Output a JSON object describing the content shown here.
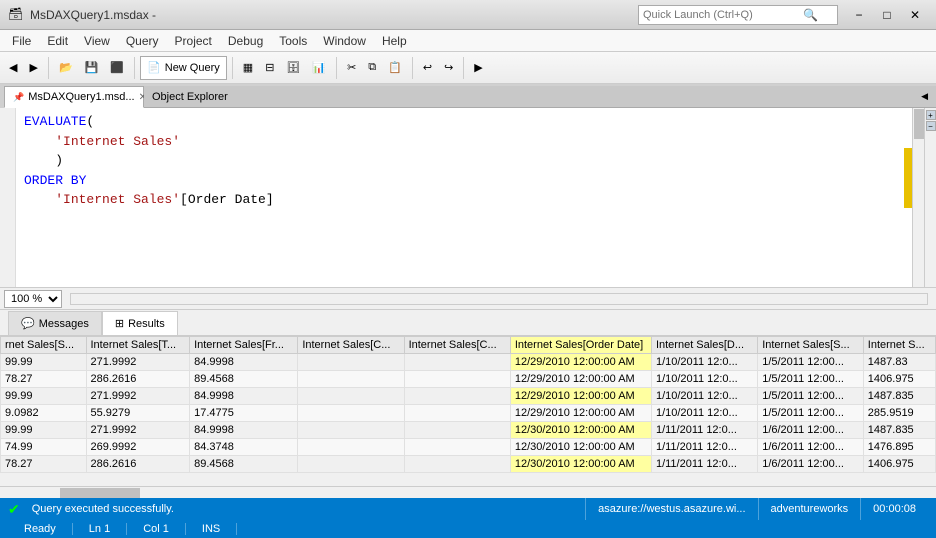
{
  "titleBar": {
    "icon": "⊞",
    "title": "MsDAXQuery1.msdax -",
    "searchPlaceholder": "Quick Launch (Ctrl+Q)",
    "minimize": "−",
    "maximize": "□",
    "close": "✕"
  },
  "menuBar": {
    "items": [
      "File",
      "Edit",
      "View",
      "Query",
      "Project",
      "Debug",
      "Tools",
      "Window",
      "Help"
    ]
  },
  "toolbar": {
    "newQueryLabel": "New Query"
  },
  "tabs": {
    "editorTab": "MsDAXQuery1.msd...",
    "objectExplorer": "Object Explorer"
  },
  "editor": {
    "line1": "EVALUATE(",
    "line2": "    'Internet Sales'",
    "line3": "    )",
    "line4": "ORDER BY",
    "line5": "    'Internet Sales'[Order Date]"
  },
  "zoom": {
    "value": "100 %"
  },
  "resultsTabs": {
    "messages": "Messages",
    "results": "Results"
  },
  "tableHeaders": [
    "rnet Sales[S...",
    "Internet Sales[T...",
    "Internet Sales[Fr...",
    "Internet Sales[C...",
    "Internet Sales[C...",
    "Internet Sales[Order Date]",
    "Internet Sales[D...",
    "Internet Sales[S...",
    "Internet S..."
  ],
  "tableRows": [
    [
      "99.99",
      "271.9992",
      "84.9998",
      "",
      "",
      "12/29/2010 12:00:00 AM",
      "1/10/2011 12:0...",
      "1/5/2011 12:00...",
      "1487.83"
    ],
    [
      "78.27",
      "286.2616",
      "89.4568",
      "",
      "",
      "12/29/2010 12:00:00 AM",
      "1/10/2011 12:0...",
      "1/5/2011 12:00...",
      "1406.975"
    ],
    [
      "99.99",
      "271.9992",
      "84.9998",
      "",
      "",
      "12/29/2010 12:00:00 AM",
      "1/10/2011 12:0...",
      "1/5/2011 12:00...",
      "1487.835"
    ],
    [
      "9.0982",
      "55.9279",
      "17.4775",
      "",
      "",
      "12/29/2010 12:00:00 AM",
      "1/10/2011 12:0...",
      "1/5/2011 12:00...",
      "285.9519"
    ],
    [
      "99.99",
      "271.9992",
      "84.9998",
      "",
      "",
      "12/30/2010 12:00:00 AM",
      "1/11/2011 12:0...",
      "1/6/2011 12:00...",
      "1487.835"
    ],
    [
      "74.99",
      "269.9992",
      "84.3748",
      "",
      "",
      "12/30/2010 12:00:00 AM",
      "1/11/2011 12:0...",
      "1/6/2011 12:00...",
      "1476.895"
    ],
    [
      "78.27",
      "286.2616",
      "89.4568",
      "",
      "",
      "12/30/2010 12:00:00 AM",
      "1/11/2011 12:0...",
      "1/6/2011 12:00...",
      "1406.975"
    ]
  ],
  "statusBar": {
    "message": "Query executed successfully.",
    "connection": "asazure://westus.asazure.wi...",
    "database": "adventureworks",
    "time": "00:00:08"
  },
  "bottomBar": {
    "ready": "Ready",
    "ln": "Ln 1",
    "col": "Col 1",
    "mode": "INS"
  }
}
